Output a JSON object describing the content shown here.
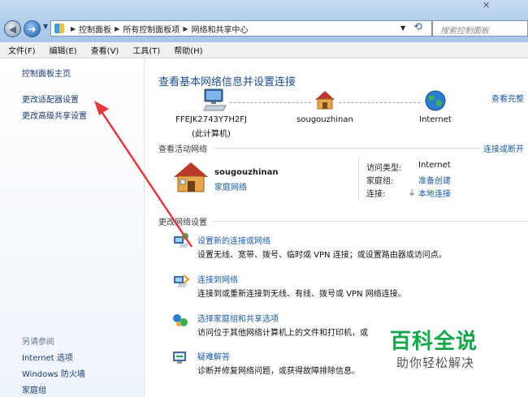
{
  "address_bar": {
    "crumbs": [
      "控制面板",
      "所有控制面板项",
      "网络和共享中心"
    ],
    "search_placeholder": "搜索控制面板"
  },
  "menu": [
    "文件(F)",
    "编辑(E)",
    "查看(V)",
    "工具(T)",
    "帮助(H)"
  ],
  "sidebar": {
    "links": [
      "控制面板主页",
      "更改适配器设置",
      "更改高级共享设置"
    ],
    "see_also_title": "另请参阅",
    "see_also": [
      "Internet 选项",
      "Windows 防火墙",
      "家庭组"
    ]
  },
  "main": {
    "title": "查看基本网络信息并设置连接",
    "see_full_map": "查看完整",
    "map": {
      "computer_name": "FFEJK2743Y7H2FJ",
      "computer_sub": "(此计算机)",
      "network_name": "sougouzhinan",
      "internet": "Internet"
    },
    "active_title": "查看活动网络",
    "connect_disconnect": "连接或断开",
    "active_network": {
      "name": "sougouzhinan",
      "type": "家庭网络",
      "access_type_label": "访问类型:",
      "access_type_value": "Internet",
      "homegroup_label": "家庭组:",
      "homegroup_value": "准备创建",
      "connection_label": "连接:",
      "connection_value": "本地连接"
    },
    "change_title": "更改网络设置",
    "tasks": [
      {
        "link": "设置新的连接或网络",
        "desc": "设置无线、宽带、拨号、临时或 VPN 连接；或设置路由器或访问点。"
      },
      {
        "link": "连接到网络",
        "desc": "连接到或重新连接到无线、有线、拨号或 VPN 网络连接。"
      },
      {
        "link": "选择家庭组和共享选项",
        "desc": "访问位于其他网络计算机上的文件和打印机，或"
      },
      {
        "link": "疑难解答",
        "desc": "诊断并修复网络问题，或获得故障排除信息。"
      }
    ]
  },
  "watermark": {
    "title": "百科全说",
    "subtitle": "助你轻松解决"
  },
  "colors": {
    "link": "#1a5aa8",
    "title": "#1e4e8c",
    "arrow": "#e8383d",
    "watermark": "#12a84a"
  }
}
